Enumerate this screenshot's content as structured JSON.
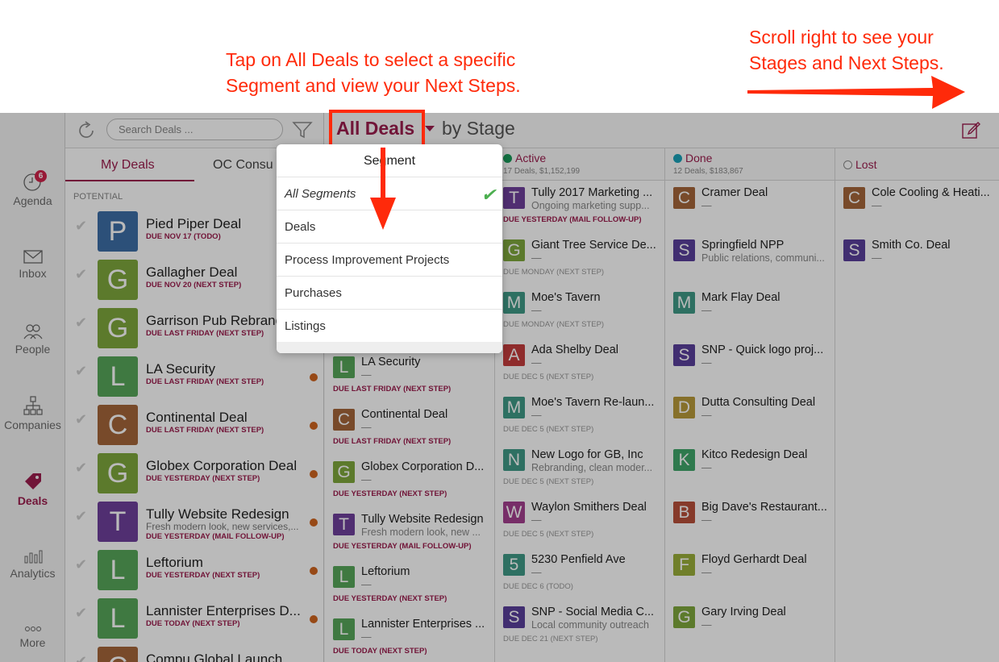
{
  "annotations": {
    "center_text_1": "Tap on All Deals to select a specific",
    "center_text_2": "Segment and view your Next Steps.",
    "right_text_1": "Scroll right to see your",
    "right_text_2": "Stages and Next Steps."
  },
  "colors": {
    "accent": "#9c1d4e",
    "annotation": "#ff2a0a",
    "active_stage": "#1a9a5a",
    "done_stage": "#1aa1b8"
  },
  "nav": {
    "agenda": "Agenda",
    "agenda_badge": "6",
    "inbox": "Inbox",
    "people": "People",
    "companies": "Companies",
    "deals": "Deals",
    "analytics": "Analytics",
    "more": "More"
  },
  "header": {
    "search_placeholder": "Search Deals ...",
    "title": "All Deals",
    "subtitle": "by Stage"
  },
  "list": {
    "tab_mine": "My Deals",
    "tab_other": "OC Consu",
    "section": "POTENTIAL",
    "rows": [
      {
        "letter": "P",
        "color": "#3d6ea6",
        "title": "Pied Piper Deal",
        "sub": "",
        "due": "DUE NOV 17 (TODO)"
      },
      {
        "letter": "G",
        "color": "#7fa83d",
        "title": "Gallagher Deal",
        "sub": "",
        "due": "DUE NOV 20 (NEXT STEP)"
      },
      {
        "letter": "G",
        "color": "#7fa83d",
        "title": "Garrison Pub Rebrand",
        "sub": "",
        "due": "DUE LAST FRIDAY (NEXT STEP)"
      },
      {
        "letter": "L",
        "color": "#57a65a",
        "title": "LA Security",
        "sub": "",
        "due": "DUE LAST FRIDAY (NEXT STEP)"
      },
      {
        "letter": "C",
        "color": "#a5663a",
        "title": "Continental Deal",
        "sub": "",
        "due": "DUE LAST FRIDAY (NEXT STEP)"
      },
      {
        "letter": "G",
        "color": "#7fa83d",
        "title": "Globex Corporation Deal",
        "sub": "",
        "due": "DUE YESTERDAY (NEXT STEP)"
      },
      {
        "letter": "T",
        "color": "#6e3f9c",
        "title": "Tully Website Redesign",
        "sub": "Fresh modern look, new services,...",
        "due": "DUE YESTERDAY (MAIL FOLLOW-UP)"
      },
      {
        "letter": "L",
        "color": "#57a65a",
        "title": "Leftorium",
        "sub": "",
        "due": "DUE YESTERDAY (NEXT STEP)"
      },
      {
        "letter": "L",
        "color": "#57a65a",
        "title": "Lannister Enterprises D...",
        "sub": "",
        "due": "DUE TODAY (NEXT STEP)"
      },
      {
        "letter": "C",
        "color": "#a5663a",
        "title": "Compu Global Launch",
        "sub": "",
        "due": ""
      }
    ]
  },
  "col1": {
    "cards": [
      {
        "letter": "L",
        "color": "#57a65a",
        "title": "LA Security",
        "sub": "—",
        "due": "DUE LAST FRIDAY (NEXT STEP)"
      },
      {
        "letter": "C",
        "color": "#a5663a",
        "title": "Continental Deal",
        "sub": "—",
        "due": "DUE LAST FRIDAY (NEXT STEP)"
      },
      {
        "letter": "G",
        "color": "#7fa83d",
        "title": "Globex Corporation D...",
        "sub": "—",
        "due": "DUE YESTERDAY (NEXT STEP)"
      },
      {
        "letter": "T",
        "color": "#6e3f9c",
        "title": "Tully Website Redesign",
        "sub": "Fresh modern look, new ...",
        "due": "DUE YESTERDAY (MAIL FOLLOW-UP)"
      },
      {
        "letter": "L",
        "color": "#57a65a",
        "title": "Leftorium",
        "sub": "—",
        "due": "DUE YESTERDAY (NEXT STEP)"
      },
      {
        "letter": "L",
        "color": "#57a65a",
        "title": "Lannister Enterprises ...",
        "sub": "—",
        "due": "DUE TODAY (NEXT STEP)"
      }
    ]
  },
  "active": {
    "name": "Active",
    "summary": "17 Deals, $1,152,199",
    "cards": [
      {
        "letter": "T",
        "color": "#6e3f9c",
        "title": "Tully 2017 Marketing ...",
        "sub": "Ongoing marketing supp...",
        "due": "DUE YESTERDAY (MAIL FOLLOW-UP)",
        "red": true
      },
      {
        "letter": "G",
        "color": "#7fa83d",
        "title": "Giant Tree Service De...",
        "sub": "—",
        "due": "DUE MONDAY (NEXT STEP)",
        "red": false
      },
      {
        "letter": "M",
        "color": "#3f9a87",
        "title": "Moe's Tavern",
        "sub": "—",
        "due": "DUE MONDAY (NEXT STEP)",
        "red": false
      },
      {
        "letter": "A",
        "color": "#c43d3d",
        "title": "Ada Shelby Deal",
        "sub": "—",
        "due": "DUE DEC 5 (NEXT STEP)",
        "red": false
      },
      {
        "letter": "M",
        "color": "#3f9a87",
        "title": "Moe's Tavern Re-laun...",
        "sub": "—",
        "due": "DUE DEC 5 (NEXT STEP)",
        "red": false
      },
      {
        "letter": "N",
        "color": "#3f9a87",
        "title": "New Logo for GB, Inc",
        "sub": "Rebranding, clean moder...",
        "due": "DUE DEC 5 (NEXT STEP)",
        "red": false
      },
      {
        "letter": "W",
        "color": "#a43f8f",
        "title": "Waylon Smithers Deal",
        "sub": "—",
        "due": "DUE DEC 5 (NEXT STEP)",
        "red": false
      },
      {
        "letter": "5",
        "color": "#3f9a87",
        "title": "5230 Penfield Ave",
        "sub": "—",
        "due": "DUE DEC 6 (TODO)",
        "red": false
      },
      {
        "letter": "S",
        "color": "#5a3f9c",
        "title": "SNP - Social Media C...",
        "sub": "Local community outreach",
        "due": "DUE DEC 21 (NEXT STEP)",
        "red": false
      }
    ]
  },
  "done": {
    "name": "Done",
    "summary": "12 Deals, $183,867",
    "cards": [
      {
        "letter": "C",
        "color": "#a5663a",
        "title": "Cramer Deal",
        "sub": "—"
      },
      {
        "letter": "S",
        "color": "#5a3f9c",
        "title": "Springfield NPP",
        "sub": "Public relations, communi..."
      },
      {
        "letter": "M",
        "color": "#3f9a87",
        "title": "Mark Flay Deal",
        "sub": "—"
      },
      {
        "letter": "S",
        "color": "#5a3f9c",
        "title": "SNP - Quick logo proj...",
        "sub": "—"
      },
      {
        "letter": "D",
        "color": "#b89a3a",
        "title": "Dutta Consulting Deal",
        "sub": "—"
      },
      {
        "letter": "K",
        "color": "#3fa66a",
        "title": "Kitco Redesign Deal",
        "sub": "—"
      },
      {
        "letter": "B",
        "color": "#b8503a",
        "title": "Big Dave's Restaurant...",
        "sub": "—"
      },
      {
        "letter": "F",
        "color": "#9aae3a",
        "title": "Floyd Gerhardt Deal",
        "sub": "—"
      },
      {
        "letter": "G",
        "color": "#7fa83d",
        "title": "Gary Irving Deal",
        "sub": "—"
      }
    ]
  },
  "lost": {
    "name": "Lost",
    "cards": [
      {
        "letter": "C",
        "color": "#a5663a",
        "title": "Cole Cooling & Heati...",
        "sub": "—"
      },
      {
        "letter": "S",
        "color": "#5a3f9c",
        "title": "Smith Co. Deal",
        "sub": "—"
      }
    ]
  },
  "popover": {
    "title": "Segment",
    "items": [
      "All Segments",
      "Deals",
      "Process Improvement Projects",
      "Purchases",
      "Listings"
    ]
  }
}
